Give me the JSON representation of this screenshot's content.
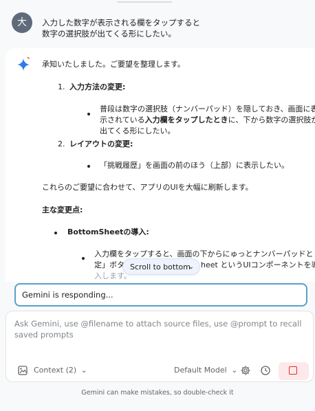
{
  "user": {
    "avatar_letter": "大",
    "message_line1": "入力した数字が表示される欄をタップすると",
    "message_line2": "数字の選択肢が出てくる形にしたい。"
  },
  "assistant": {
    "intro": "承知いたしました。ご要望を整理します。",
    "item1_num": "1.",
    "item1_title": "入力方法の変更:",
    "item1_bullet_line1": "普段は数字の選択肢（ナンバーパッド）を隠しておき、画面に表",
    "item1_bullet_line2_pre": "示されている",
    "item1_bullet_line2_bold": "入力欄をタップしたとき",
    "item1_bullet_line2_post": "に、下から数字の選択肢が",
    "item1_bullet_line3": "出てくる形にしたい。",
    "item2_num": "2.",
    "item2_title": "レイアウトの変更:",
    "item2_bullet": "「挑戦履歴」を画面の前のほう（上部）に表示したい。",
    "para": "これらのご要望に合わせて、アプリのUIを大幅に刷新します。",
    "heading": "主な変更点:",
    "point_title": "BottomSheetの導入:",
    "sub_line1": "入力欄をタップすると、画面の下からにゅっとナンバーパッドと「判",
    "sub_line2_pre": "定」ボタン",
    "sub_line2_post": "heet というUIコンポーネントを導",
    "sub_line3": "入します。"
  },
  "scroll_pill": {
    "label": "Scroll to bottom",
    "icon": "chevron-down-icon"
  },
  "responding": {
    "text": "Gemini is responding..."
  },
  "input": {
    "placeholder": "Ask Gemini, use @filename to attach source files, use @prompt to recall saved prompts"
  },
  "toolbar": {
    "context_label": "Context (2)",
    "model_label": "Default Model",
    "icons": [
      "attach-image-icon",
      "chevron-down-icon",
      "gear-icon",
      "history-icon",
      "stop-icon"
    ]
  },
  "disclaimer": "Gemini can make mistakes, so double-check it",
  "colors": {
    "accent_blue": "#4285f4",
    "stop_red": "#d93025",
    "stop_bg": "#fde8ea",
    "border_focus": "#5aa0c8"
  }
}
